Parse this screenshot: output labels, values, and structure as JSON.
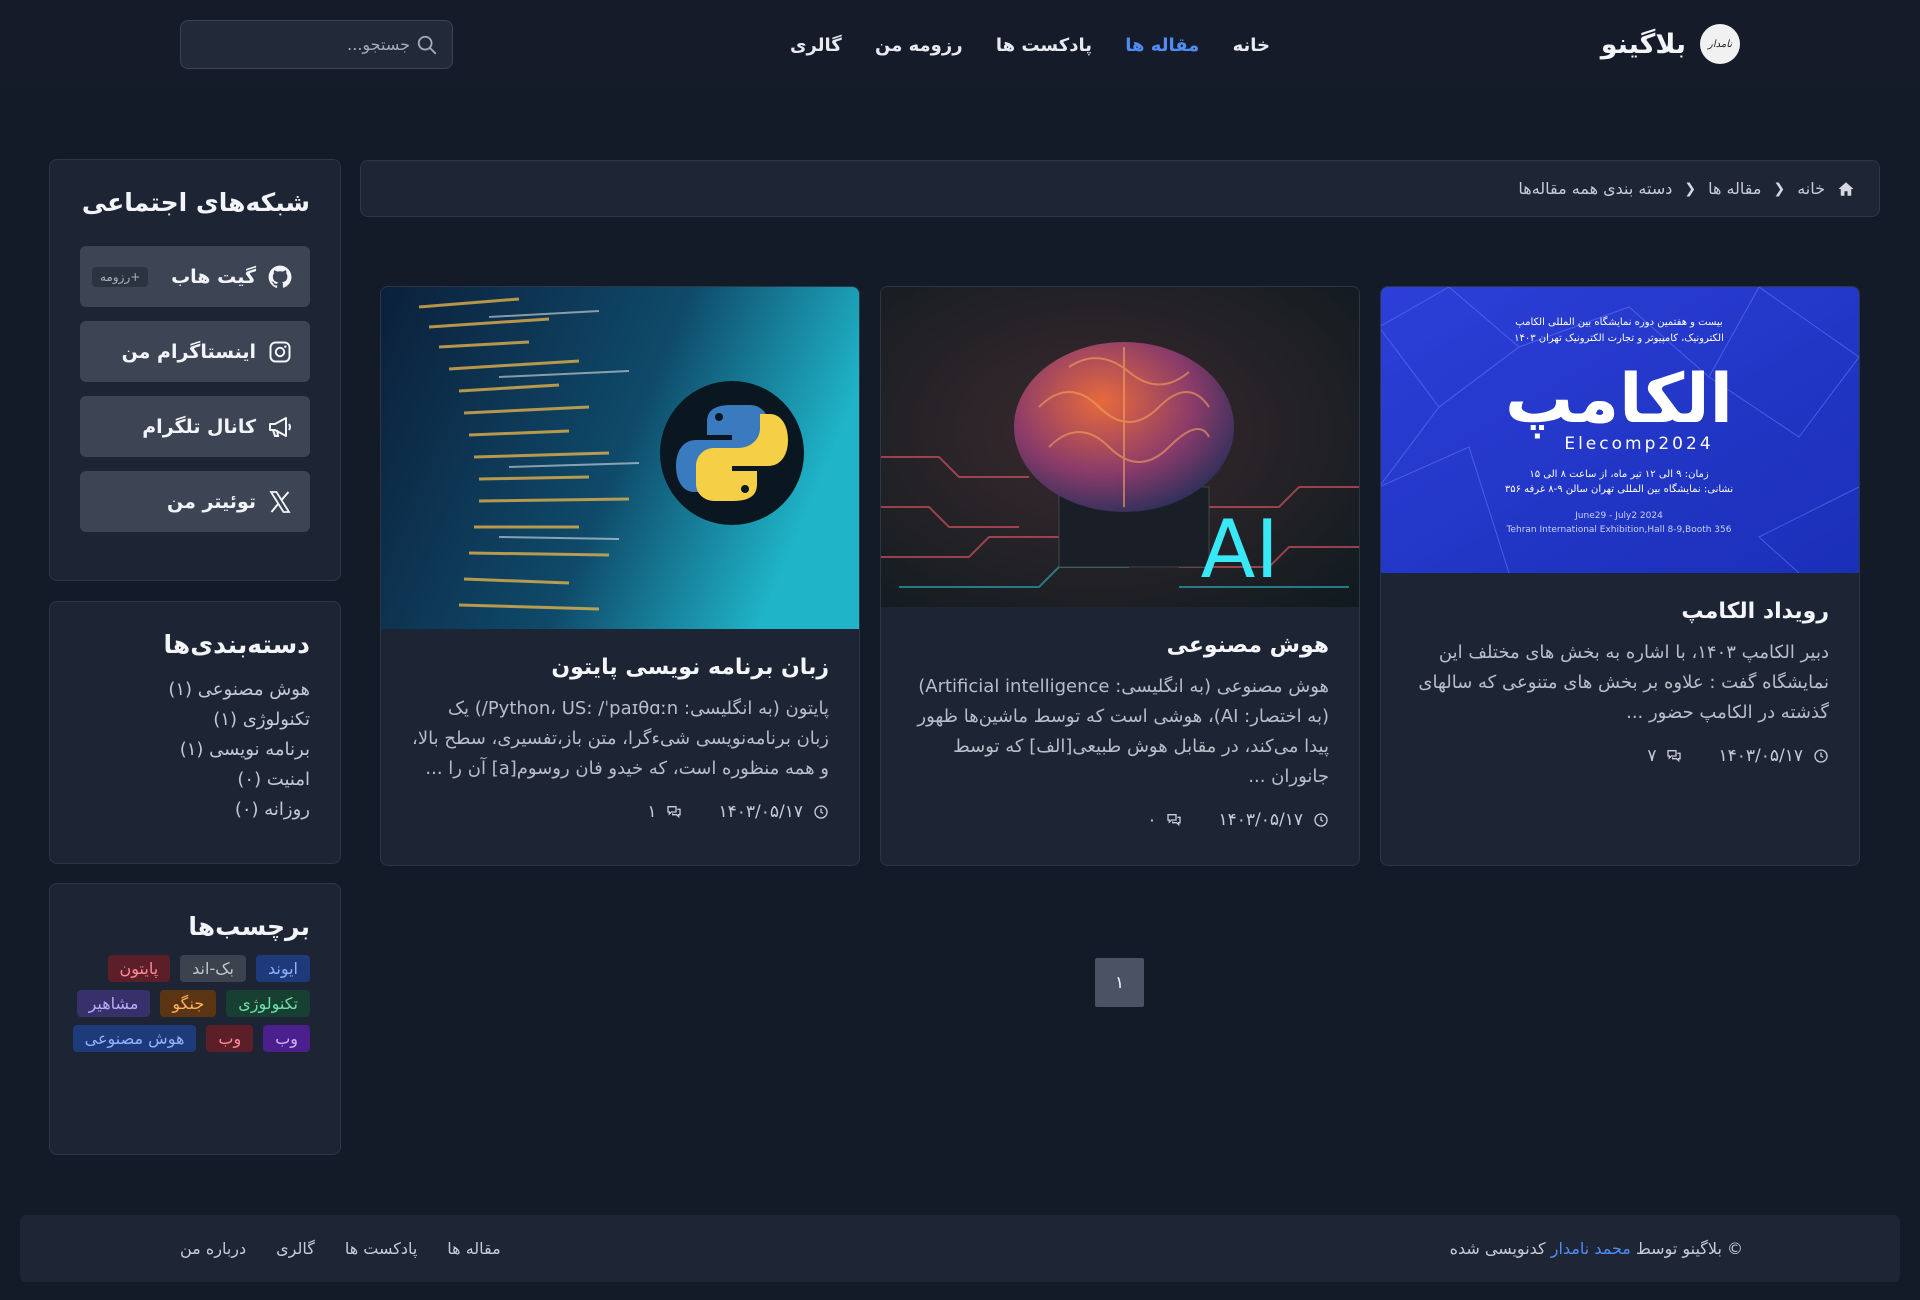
{
  "header": {
    "brand_name": "بلاگینو",
    "logo_text": "نامدار",
    "nav": [
      "خانه",
      "مقاله ها",
      "پادکست ها",
      "رزومه من",
      "گالری"
    ],
    "active_nav": "مقاله ها",
    "search_placeholder": "جستجو...",
    "accent_color": "#4f8df5"
  },
  "breadcrumb": {
    "home": "خانه",
    "articles": "مقاله ها",
    "current": "دسته بندی همه مقاله‌ها"
  },
  "social": {
    "title": "شبکه‌های اجتماعی",
    "items": [
      {
        "label": "گیت هاب",
        "icon": "github-icon",
        "badge": "+رزومه"
      },
      {
        "label": "اینستاگرام من",
        "icon": "instagram-icon"
      },
      {
        "label": "کانال تلگرام",
        "icon": "megaphone-icon"
      },
      {
        "label": "توئیتر من",
        "icon": "x-icon"
      }
    ]
  },
  "categories": {
    "title": "دسته‌بندی‌ها",
    "items": [
      "هوش مصنوعی (۱)",
      "تکنولوژی (۱)",
      "برنامه نویسی (۱)",
      "امنیت (۰)",
      "روزانه (۰)"
    ]
  },
  "tags": {
    "title": "برچسب‌ها",
    "items": [
      {
        "label": "ایوند",
        "bg": "#1f3a7a",
        "fg": "#8fb2ff"
      },
      {
        "label": "بک-اند",
        "bg": "#3c424e",
        "fg": "#c4c8d0"
      },
      {
        "label": "پایتون",
        "bg": "#5c1f2a",
        "fg": "#ff8a96"
      },
      {
        "label": "تکنولوژی",
        "bg": "#173f32",
        "fg": "#6ee0a9"
      },
      {
        "label": "جنگو",
        "bg": "#5a3413",
        "fg": "#ffb060"
      },
      {
        "label": "مشاهیر",
        "bg": "#37306a",
        "fg": "#b6acff"
      },
      {
        "label": "وب",
        "bg": "#4b1f8c",
        "fg": "#d0b4ff"
      },
      {
        "label": "وب",
        "bg": "#5c1f2a",
        "fg": "#ff8a96"
      },
      {
        "label": "هوش مصنوعی",
        "bg": "#1f3a7a",
        "fg": "#8fb2ff"
      }
    ]
  },
  "posts": [
    {
      "title": "رویداد الکامپ",
      "excerpt": "دبیر الکامپ ۱۴۰۳، با اشاره به بخش های مختلف این نمایشگاه گفت : علاوه بر بخش های متنوعی که سالهای گذشته در الکامپ حضور ...",
      "date": "۱۴۰۳/۰۵/۱۷",
      "comments": "۷",
      "image": {
        "headline": "بیست و هفتمین دوره نمایشگاه بین المللی الکامپ",
        "subline": "الکترونیک، کامپیوتر و تجارت الکترونیک تهران ۱۴۰۳",
        "logo": "الکامپ",
        "logo_en": "Elecomp2024",
        "time_line": "زمان: ۹ الی ۱۲ تیر ماه، از ساعت ۸ الی ۱۵",
        "place_line": "نشانی: نمایشگاه بین المللی تهران سالن ۹-۸ غرفه ۳۵۶",
        "date_en": "June29 - July2 2024",
        "place_en": "Tehran International Exhibition,Hall 8-9,Booth 356"
      }
    },
    {
      "title": "هوش مصنوعی",
      "excerpt": "هوش مصنوعی (به انگلیسی: Artificial intelligence) (به اختصار: AI)، هوشی است که توسط ماشین‌ها ظهور پیدا می‌کند، در مقابل هوش طبیعی[الف] که توسط جانوران ...",
      "date": "۱۴۰۳/۰۵/۱۷",
      "comments": "۰",
      "image": {
        "label": "AI"
      }
    },
    {
      "title": "زبان برنامه نویسی پایتون",
      "excerpt": "پایتون (به انگلیسی: Python، US: /ˈpaɪθɑːn/) یک زبان برنامه‌نویسی شیء‌گرا، متن باز،تفسیری، سطح بالا، و همه منظوره است، که خیدو فان روسوم[a] آن را ...",
      "date": "۱۴۰۳/۰۵/۱۷",
      "comments": "۱",
      "image": {
        "label": "python"
      }
    }
  ],
  "pagination": {
    "current": "۱"
  },
  "footer": {
    "copyright_prefix": "© بلاگینو توسط",
    "author": "محمد نامدار",
    "copyright_suffix": "کدنویسی شده",
    "links": [
      "مقاله ها",
      "پادکست ها",
      "گالری",
      "درباره من"
    ]
  }
}
